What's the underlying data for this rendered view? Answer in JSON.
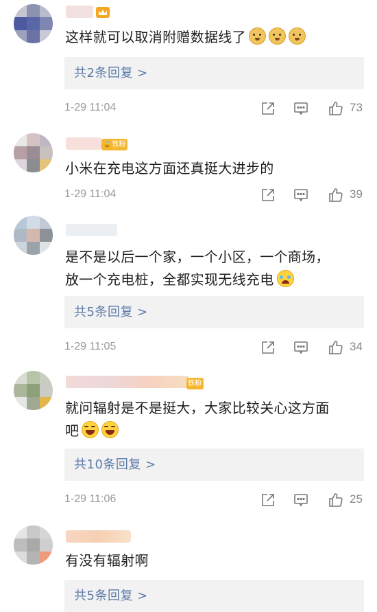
{
  "comments": [
    {
      "text": "这样就可以取消附赠数据线了",
      "emojis": [
        "doge",
        "doge",
        "doge"
      ],
      "reply_label": "共2条回复 >",
      "time": "1-29 11:04",
      "likes": "73",
      "badge": null
    },
    {
      "text": "小米在充电这方面还真挺大进步的",
      "emojis": [],
      "reply_label": null,
      "time": "1-29 11:04",
      "likes": "39",
      "badge": "铁粉"
    },
    {
      "text_line1": "是不是以后一个家，一个小区，一个商场，",
      "text_line2": "放一个充电桩，全都实现无线充电",
      "emojis": [
        "cry"
      ],
      "reply_label": "共5条回复 >",
      "time": "1-29 11:05",
      "likes": "34",
      "badge": null
    },
    {
      "text_line1": "就问辐射是不是挺大，大家比较关心这方面",
      "text_line2": "吧",
      "emojis": [
        "laugh",
        "laugh"
      ],
      "reply_label": "共10条回复 >",
      "time": "1-29 11:06",
      "likes": "25",
      "badge": "铁粉"
    },
    {
      "text": "有没有辐射啊",
      "emojis": [],
      "reply_label": "共5条回复 >",
      "time": null,
      "likes": null,
      "badge": null
    }
  ],
  "icons": {
    "share": "share-icon",
    "comment": "comment-icon",
    "like": "thumbs-up-icon"
  },
  "colors": {
    "reply_text": "#5b7ba8",
    "reply_bg": "#f2f2f2",
    "meta_text": "#999999",
    "badge": "#f5b731"
  }
}
